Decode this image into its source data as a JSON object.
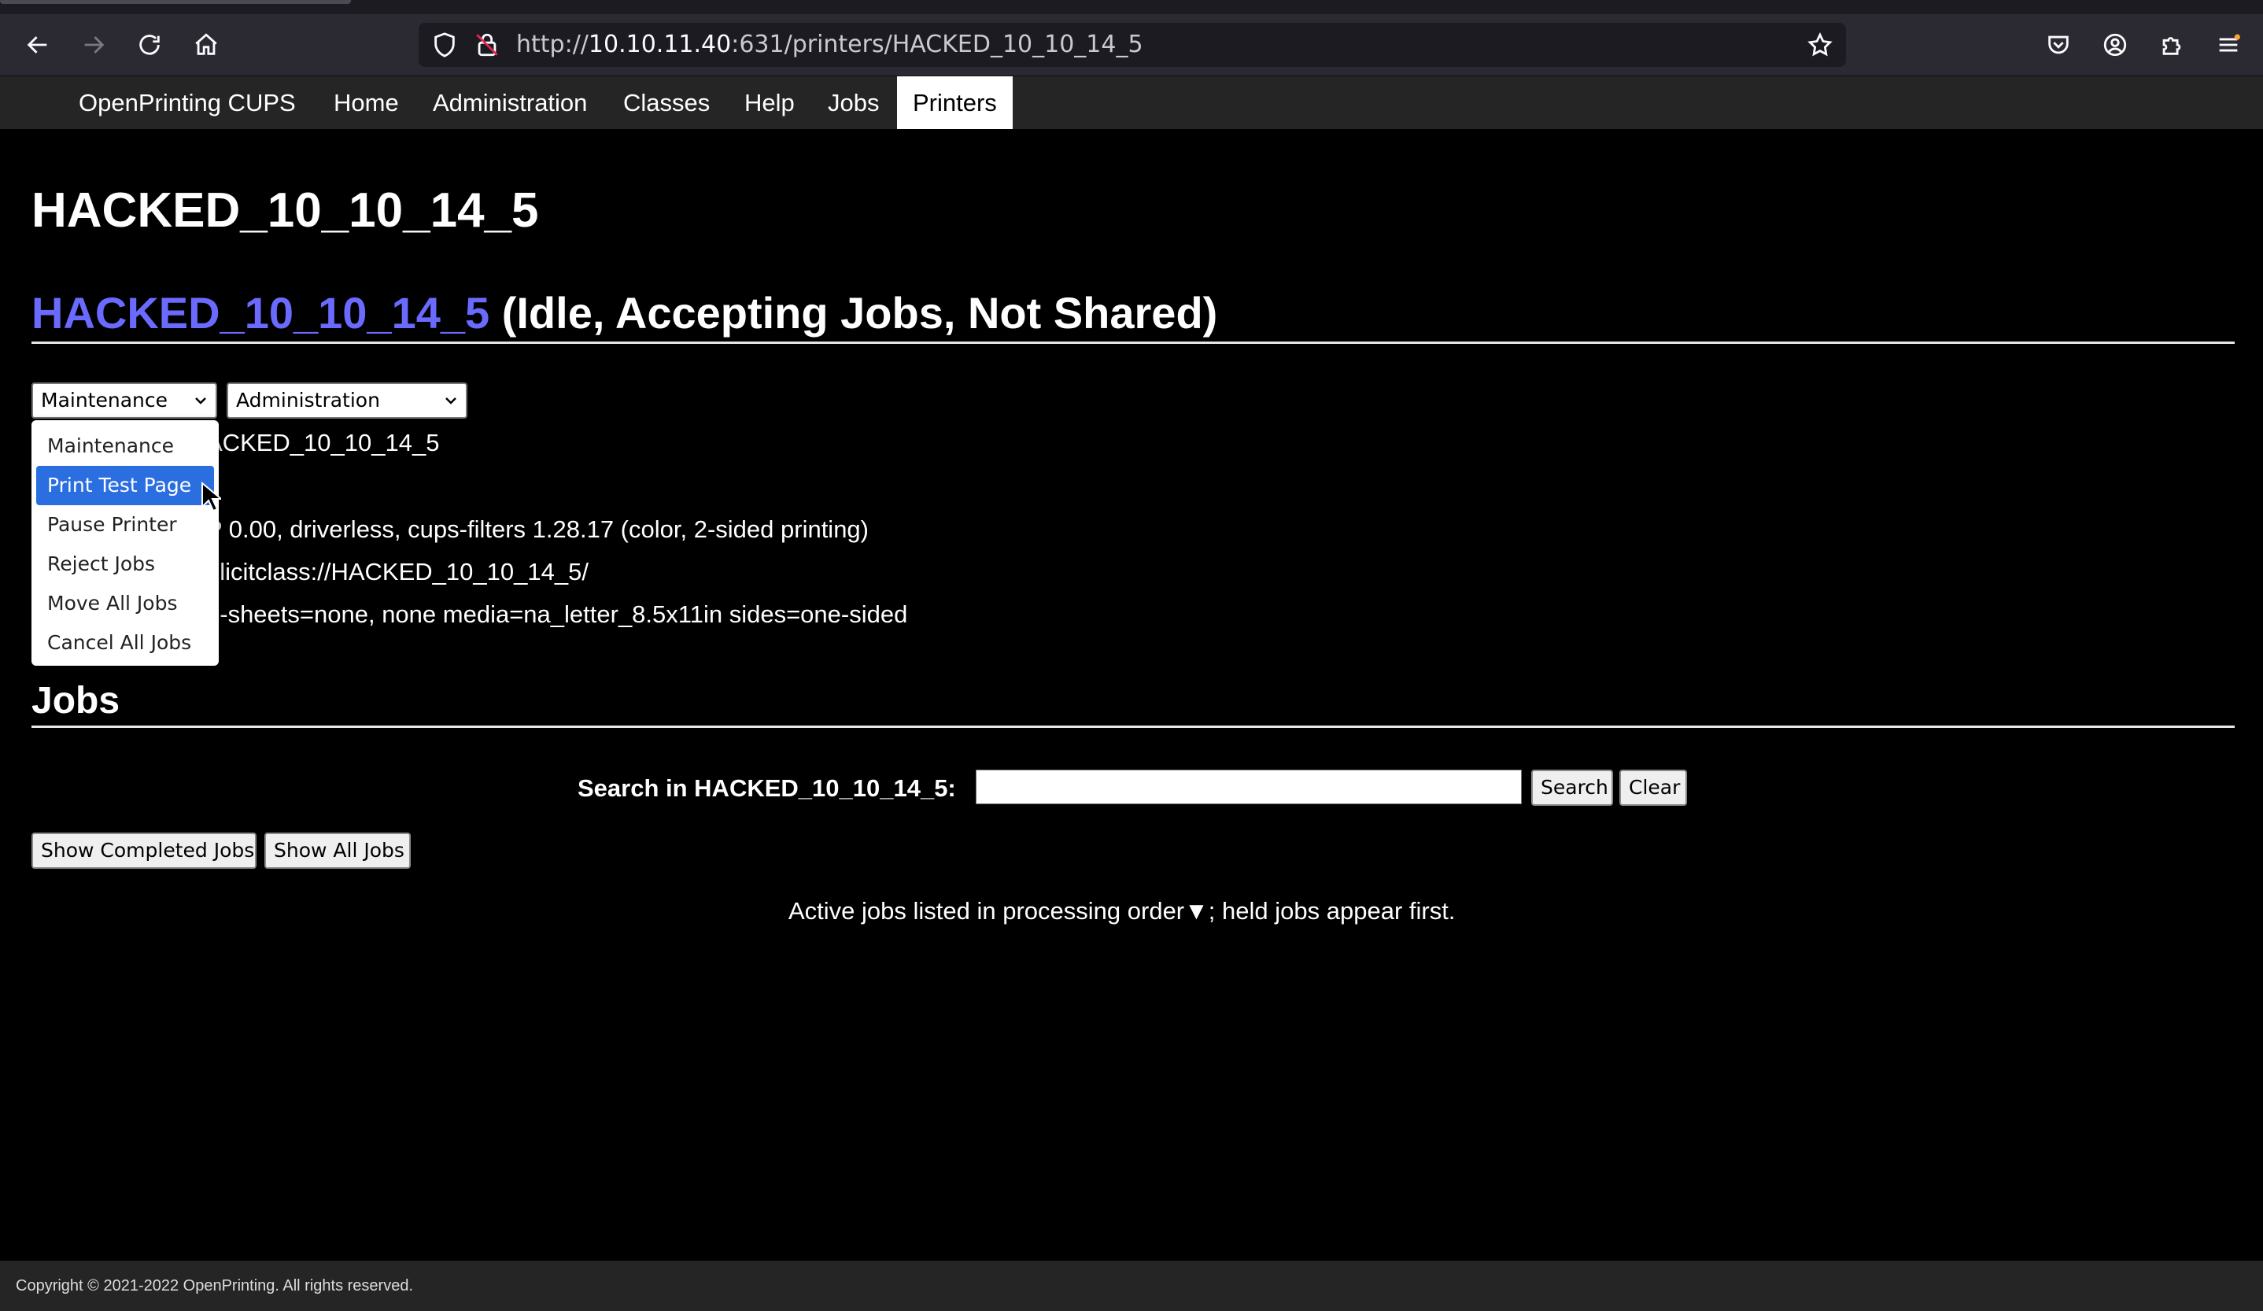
{
  "browser": {
    "url_prefix": "http://",
    "url_host": "10.10.11.40",
    "url_rest": ":631/printers/HACKED_10_10_14_5",
    "icons": {
      "back": "arrow-left-icon",
      "forward": "arrow-right-icon",
      "reload": "reload-icon",
      "home": "home-icon",
      "shield": "tracking-protection-shield-icon",
      "lock": "insecure-lock-icon",
      "bookmark": "star-icon",
      "pocket": "pocket-icon",
      "account": "account-icon",
      "extensions": "puzzle-icon",
      "menu": "hamburger-menu-icon"
    }
  },
  "nav": {
    "brand": "OpenPrinting CUPS",
    "items": [
      "Home",
      "Administration",
      "Classes",
      "Help",
      "Jobs",
      "Printers"
    ],
    "active": "Printers"
  },
  "page": {
    "title": "HACKED_10_10_14_5",
    "printer_name": "HACKED_10_10_14_5",
    "printer_status": "(Idle, Accepting Jobs, Not Shared)"
  },
  "selects": {
    "maintenance": "Maintenance",
    "administration": "Administration"
  },
  "dropdown": {
    "options": [
      "Maintenance",
      "Print Test Page",
      "Pause Printer",
      "Reject Jobs",
      "Move All Jobs",
      "Cancel All Jobs"
    ],
    "highlighted": "Print Test Page"
  },
  "printer_info": {
    "description_partial": "ACKED_10_10_14_5",
    "driver_partial": "P 0.00, driverless, cups-filters 1.28.17 (color, 2-sided printing)",
    "connection_partial": "plicitclass://HACKED_10_10_14_5/",
    "defaults_partial": "o-sheets=none, none media=na_letter_8.5x11in sides=one-sided"
  },
  "jobs": {
    "heading": "Jobs",
    "search_label": "Search in HACKED_10_10_14_5:",
    "search_value": "",
    "search_button": "Search",
    "clear_button": "Clear",
    "show_completed": "Show Completed Jobs",
    "show_all": "Show All Jobs",
    "note": "Active jobs listed in processing order▼; held jobs appear first."
  },
  "footer": {
    "copyright": "Copyright © 2021-2022 OpenPrinting. All rights reserved."
  },
  "colors": {
    "background": "#000000",
    "nav_bar": "#252525",
    "link": "#6a6aff",
    "highlight": "#2a6ee0"
  }
}
